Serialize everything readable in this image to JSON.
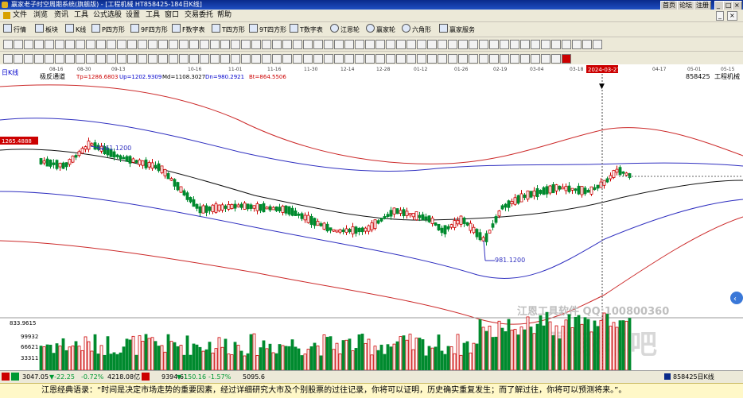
{
  "window": {
    "title": "赢家老子时空周期系统(旗舰版) - [工程机械  HT858425-184日K线]",
    "top_right": [
      "首页",
      "论坛",
      "注册"
    ]
  },
  "menu": [
    "文件",
    "浏览",
    "资讯",
    "工具",
    "公式选股",
    "设置",
    "工具",
    "窗口",
    "交易委托",
    "帮助"
  ],
  "toolbar1": [
    "行情",
    "板块",
    "K线",
    "P四方形",
    "9F四方形",
    "F数字表",
    "T四方形",
    "9T四方形",
    "T数字表",
    "江恩轮",
    "赢家轮",
    "六角形",
    "赢家服务"
  ],
  "toolbar3_extra": "2024-03-27",
  "chart": {
    "period_label": "日K线",
    "indicator": "极反通道",
    "params": [
      "Tp=1286.6803",
      "Up=1202.9309",
      "Md=1108.3027",
      "Dn=980.2921",
      "Bt=864.5506"
    ],
    "right_code": "858425",
    "right_name": "工程机械",
    "price_marker": "1265.4888",
    "cursor_date": "2024-03-27",
    "high_label": "1261.1200",
    "low_label": "981.1200",
    "vol_axis": [
      "833.9615",
      "99932",
      "66621",
      "33311"
    ],
    "watermark_text": "江恩工具软件  QQ:100800360",
    "watermark_brand": "赢家聊吧",
    "date_ticks": [
      "08-16",
      "08-30",
      "09-13",
      "10-16",
      "11-01",
      "11-16",
      "11-30",
      "12-14",
      "12-28",
      "01-12",
      "01-26",
      "02-19",
      "03-04",
      "03-18",
      "04-17",
      "05-01",
      "05-15"
    ]
  },
  "chart_data": {
    "type": "candlestick",
    "indicator_values": {
      "Tp": 1286.6803,
      "Up": 1202.9309,
      "Md": 1108.3027,
      "Dn": 980.2921,
      "Bt": 864.5506
    },
    "annotations": {
      "high": 1261.12,
      "low": 981.12,
      "marker": 1265.4888
    }
  },
  "status": {
    "idx1": "3047.05",
    "idx1_chg": "▼-22.25",
    "idx1_pct": "-0.72%",
    "idx1_amt": "4218.08亿",
    "idx2": "9394.61",
    "idx2_chg": "▼-150.16",
    "idx2_pct": "-1.57%",
    "idx2_amt": "5095.6",
    "right": "858425日K线"
  },
  "quote": "江恩经典语录：“时间是决定市场走势的重要因素，经过详细研究大市及个别股票的过往记录，你将可以证明，历史确实重复发生；而了解过往，你将可以预测将来。”。"
}
